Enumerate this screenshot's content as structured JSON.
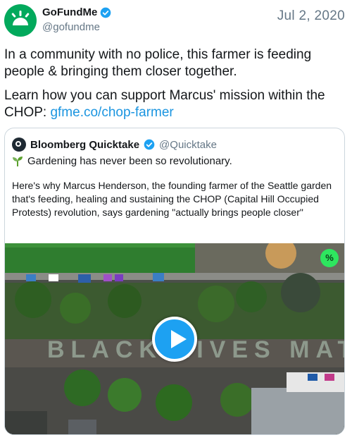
{
  "author": {
    "name": "GoFundMe",
    "handle": "@gofundme",
    "date": "Jul 2, 2020"
  },
  "tweet": {
    "line1": "In a community with no police, this farmer is feeding people & bringing them closer together.",
    "line2_prefix": "Learn how you can support Marcus' mission within the CHOP: ",
    "link": "gfme.co/chop-farmer"
  },
  "quoted": {
    "name": "Bloomberg Quicktake",
    "handle": "@Quicktake",
    "subtitle": "Gardening has never been  so revolutionary.",
    "body": "Here's why Marcus Henderson, the founding farmer of the Seattle garden that's feeding, healing and sustaining the CHOP (Capital Hill Occupied Protests) revolution, says gardening \"actually brings people closer\"",
    "video_badge": "%"
  },
  "colors": {
    "brand_green": "#02a95c",
    "link_blue": "#1b95e0",
    "play_blue": "#1da1f2"
  }
}
